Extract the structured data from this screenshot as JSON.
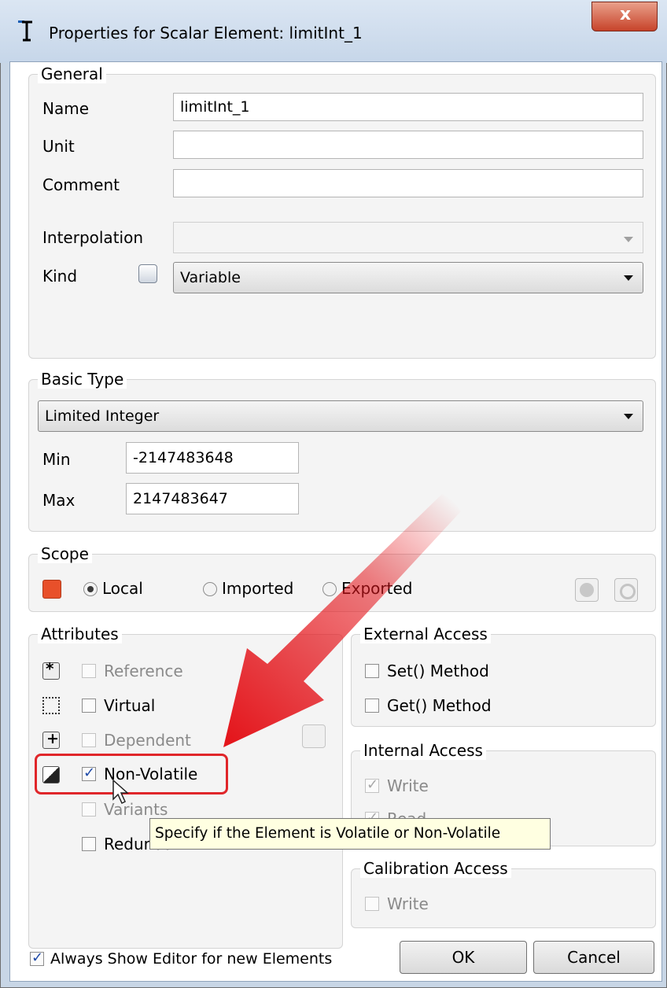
{
  "window": {
    "title": "Properties for Scalar Element: limitInt_1",
    "close_glyph": "x"
  },
  "general": {
    "legend": "General",
    "name_label": "Name",
    "name_value": "limitInt_1",
    "unit_label": "Unit",
    "unit_value": "",
    "comment_label": "Comment",
    "comment_value": "",
    "interpolation_label": "Interpolation",
    "interpolation_value": "",
    "kind_label": "Kind",
    "kind_value": "Variable"
  },
  "basic_type": {
    "legend": "Basic Type",
    "type_value": "Limited Integer",
    "min_label": "Min",
    "min_value": "-2147483648",
    "max_label": "Max",
    "max_value": "2147483647"
  },
  "scope": {
    "legend": "Scope",
    "local_label": "Local",
    "imported_label": "Imported",
    "exported_label": "Exported",
    "selected": "Local",
    "color": "#e8502a"
  },
  "attributes": {
    "legend": "Attributes",
    "reference_label": "Reference",
    "virtual_label": "Virtual",
    "dependent_label": "Dependent",
    "nonvolatile_label": "Non-Volatile",
    "nonvolatile_checked": true,
    "variants_label": "Variants",
    "redundant_label": "Redundant"
  },
  "external_access": {
    "legend": "External Access",
    "set_label": "Set() Method",
    "get_label": "Get() Method"
  },
  "internal_access": {
    "legend": "Internal Access",
    "write_label": "Write",
    "read_label": "Read"
  },
  "calibration_access": {
    "legend": "Calibration Access",
    "write_label": "Write"
  },
  "tooltip": {
    "text": "Specify if the Element is Volatile or Non-Volatile"
  },
  "footer": {
    "always_show_label": "Always Show Editor for new Elements",
    "always_show_checked": true,
    "ok_label": "OK",
    "cancel_label": "Cancel"
  },
  "colors": {
    "highlight": "#e0262a",
    "arrow": "#e4161c"
  }
}
